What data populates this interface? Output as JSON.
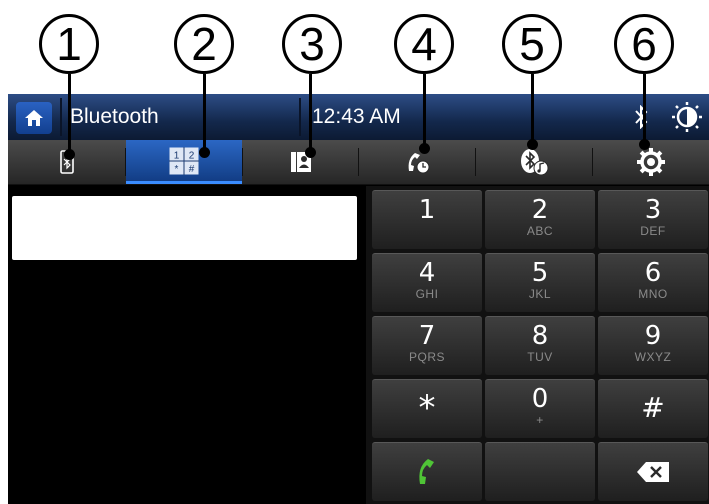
{
  "callouts": [
    "1",
    "2",
    "3",
    "4",
    "5",
    "6"
  ],
  "header": {
    "title": "Bluetooth",
    "time": "12:43 AM"
  },
  "tabs": [
    {
      "name": "bluetooth-phone",
      "icon": "phone-bluetooth-icon"
    },
    {
      "name": "dial-pad",
      "icon": "keypad-icon",
      "active": true,
      "keys": [
        "1",
        "2",
        "*",
        "#"
      ]
    },
    {
      "name": "contacts",
      "icon": "contacts-icon"
    },
    {
      "name": "call-history",
      "icon": "call-history-icon"
    },
    {
      "name": "bluetooth-audio",
      "icon": "bluetooth-music-icon"
    },
    {
      "name": "settings",
      "icon": "gear-icon"
    }
  ],
  "keypad": [
    {
      "digit": "1",
      "letters": ""
    },
    {
      "digit": "2",
      "letters": "ABC"
    },
    {
      "digit": "3",
      "letters": "DEF"
    },
    {
      "digit": "4",
      "letters": "GHI"
    },
    {
      "digit": "5",
      "letters": "JKL"
    },
    {
      "digit": "6",
      "letters": "MNO"
    },
    {
      "digit": "7",
      "letters": "PQRS"
    },
    {
      "digit": "8",
      "letters": "TUV"
    },
    {
      "digit": "9",
      "letters": "WXYZ"
    },
    {
      "digit": "*",
      "letters": ""
    },
    {
      "digit": "0",
      "letters": "+"
    },
    {
      "digit": "#",
      "letters": ""
    }
  ],
  "colors": {
    "call": "#4fc436",
    "accent": "#2a66c4",
    "header": "#1b3460"
  }
}
